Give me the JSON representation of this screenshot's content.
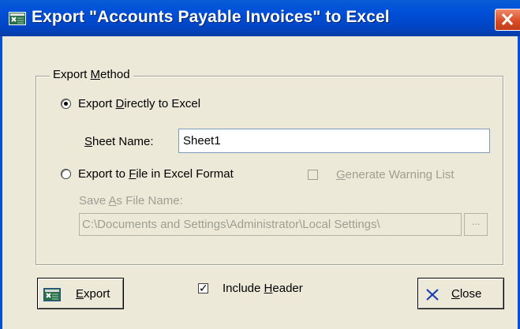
{
  "window": {
    "title": "Export \"Accounts Payable Invoices\" to Excel",
    "title_bar_color": "#0050d8",
    "background": "#ece9d8"
  },
  "export_method": {
    "group_label_pre": "Export ",
    "group_label_ul": "M",
    "group_label_post": "ethod",
    "direct": {
      "label_pre": "Export ",
      "label_ul": "D",
      "label_post": "irectly to Excel",
      "selected": true,
      "sheet_name_label_pre": "",
      "sheet_name_label_ul": "S",
      "sheet_name_label_post": "heet Name:",
      "sheet_name_value": "Sheet1"
    },
    "file": {
      "label_pre": "Export to ",
      "label_ul": "F",
      "label_post": "ile in Excel Format",
      "selected": false,
      "warning_pre": "",
      "warning_ul": "G",
      "warning_post": "enerate Warning List",
      "warning_checked": false,
      "save_as_label_pre": "Save ",
      "save_as_label_ul": "A",
      "save_as_label_post": "s File Name:",
      "save_as_value": "C:\\Documents and Settings\\Administrator\\Local Settings\\",
      "browse_label": "..."
    }
  },
  "footer": {
    "export_pre": "",
    "export_ul": "E",
    "export_post": "xport",
    "include_header_pre": "Include ",
    "include_header_ul": "H",
    "include_header_post": "eader",
    "include_header_checked": true,
    "close_pre": "",
    "close_ul": "C",
    "close_post": "lose"
  },
  "icons": {
    "title": "excel-export-icon",
    "close": "close-x-icon",
    "export": "excel-export-icon",
    "close_button": "x-icon"
  }
}
